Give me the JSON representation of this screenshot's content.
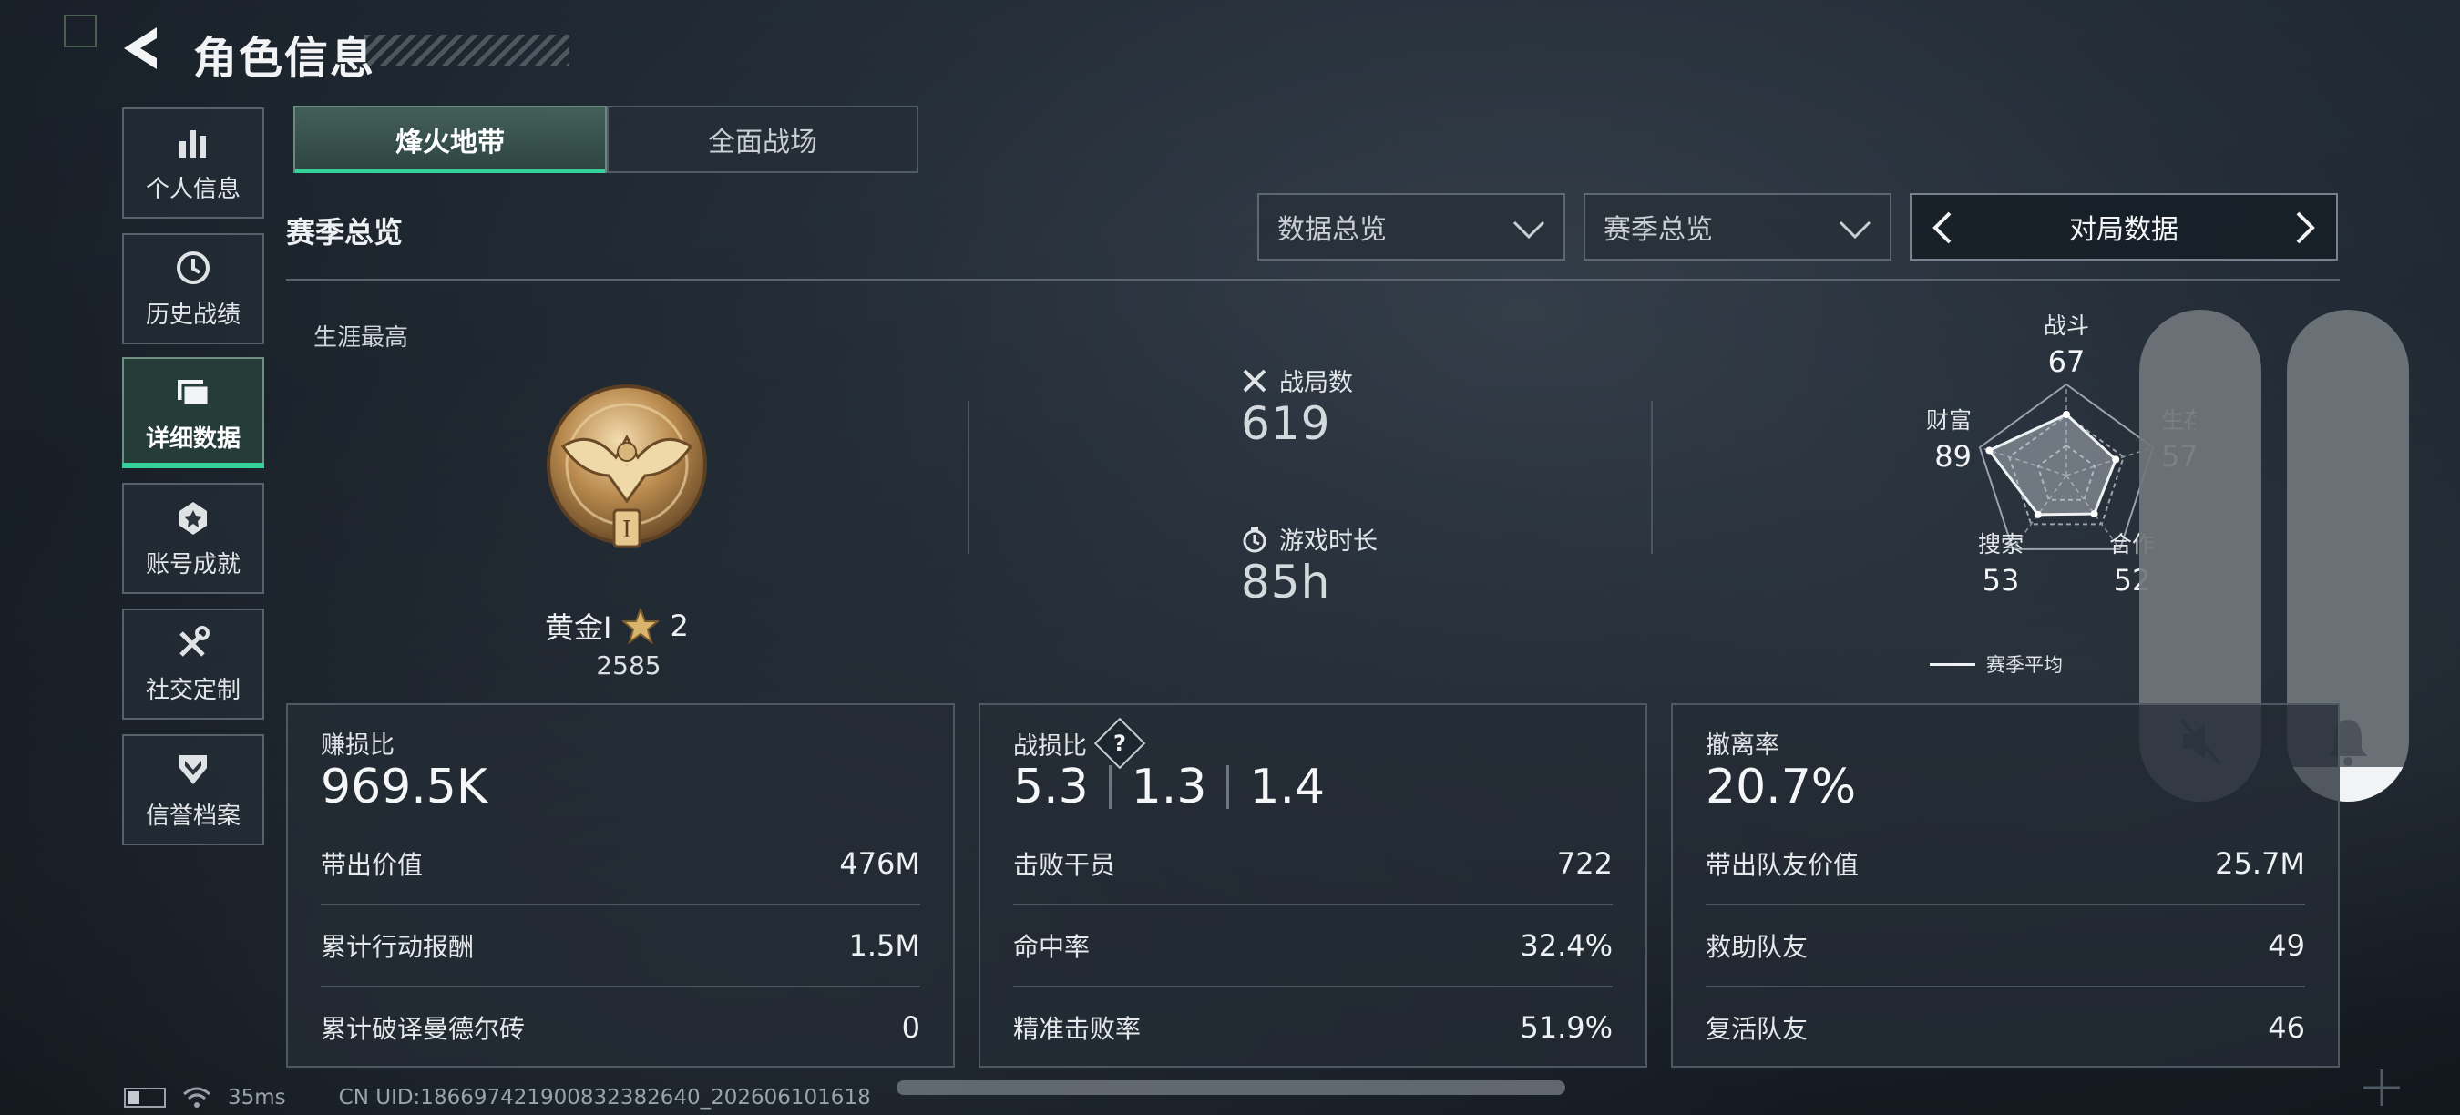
{
  "header": {
    "title": "角色信息"
  },
  "sidebar": {
    "items": [
      {
        "label": "个人信息",
        "icon": "bar-chart-icon"
      },
      {
        "label": "历史战绩",
        "icon": "history-clock-icon"
      },
      {
        "label": "详细数据",
        "icon": "folder-icon",
        "active": true
      },
      {
        "label": "账号成就",
        "icon": "achievement-badge-icon"
      },
      {
        "label": "社交定制",
        "icon": "tools-icon"
      },
      {
        "label": "信誉档案",
        "icon": "shield-rank-icon"
      }
    ]
  },
  "tabs": [
    {
      "label": "烽火地带",
      "active": true
    },
    {
      "label": "全面战场",
      "active": false
    }
  ],
  "section": {
    "title": "赛季总览"
  },
  "filters": {
    "dropdown1": "数据总览",
    "dropdown2": "赛季总览",
    "pager_label": "对局数据"
  },
  "career": {
    "label": "生涯最高",
    "rank_name": "黄金Ⅰ",
    "stars": "2",
    "points": "2585",
    "medal_tier": "I"
  },
  "matches": {
    "label": "战局数",
    "value": "619"
  },
  "playtime": {
    "label": "游戏时长",
    "value": "85h"
  },
  "radar": {
    "axes": [
      {
        "label": "战斗",
        "value": 67
      },
      {
        "label": "生存",
        "value": 57
      },
      {
        "label": "合作",
        "value": 52
      },
      {
        "label": "搜索",
        "value": 53
      },
      {
        "label": "财富",
        "value": 89
      }
    ],
    "legend": "赛季平均"
  },
  "cards": {
    "profit": {
      "title": "赚损比",
      "big": "969.5K",
      "rows": [
        {
          "label": "带出价值",
          "value": "476M"
        },
        {
          "label": "累计行动报酬",
          "value": "1.5M"
        },
        {
          "label": "累计破译曼德尔砖",
          "value": "0"
        }
      ]
    },
    "combat": {
      "title": "战损比",
      "help": "?",
      "ratios": [
        "5.3",
        "1.3",
        "1.4"
      ],
      "rows": [
        {
          "label": "击败干员",
          "value": "722"
        },
        {
          "label": "命中率",
          "value": "32.4%"
        },
        {
          "label": "精准击败率",
          "value": "51.9%"
        }
      ]
    },
    "extract": {
      "title": "撤离率",
      "big": "20.7%",
      "rows": [
        {
          "label": "带出队友价值",
          "value": "25.7M"
        },
        {
          "label": "救助队友",
          "value": "49"
        },
        {
          "label": "复活队友",
          "value": "46"
        }
      ]
    }
  },
  "overlay": {
    "mute_level": 0,
    "ring_level": 0.07
  },
  "footer": {
    "battery_level": 0.4,
    "ping": "35ms",
    "uid": "CN UID:1866974219008323826​40_202606101618"
  },
  "colors": {
    "accent": "#34d29a",
    "background": "#1f2832"
  }
}
